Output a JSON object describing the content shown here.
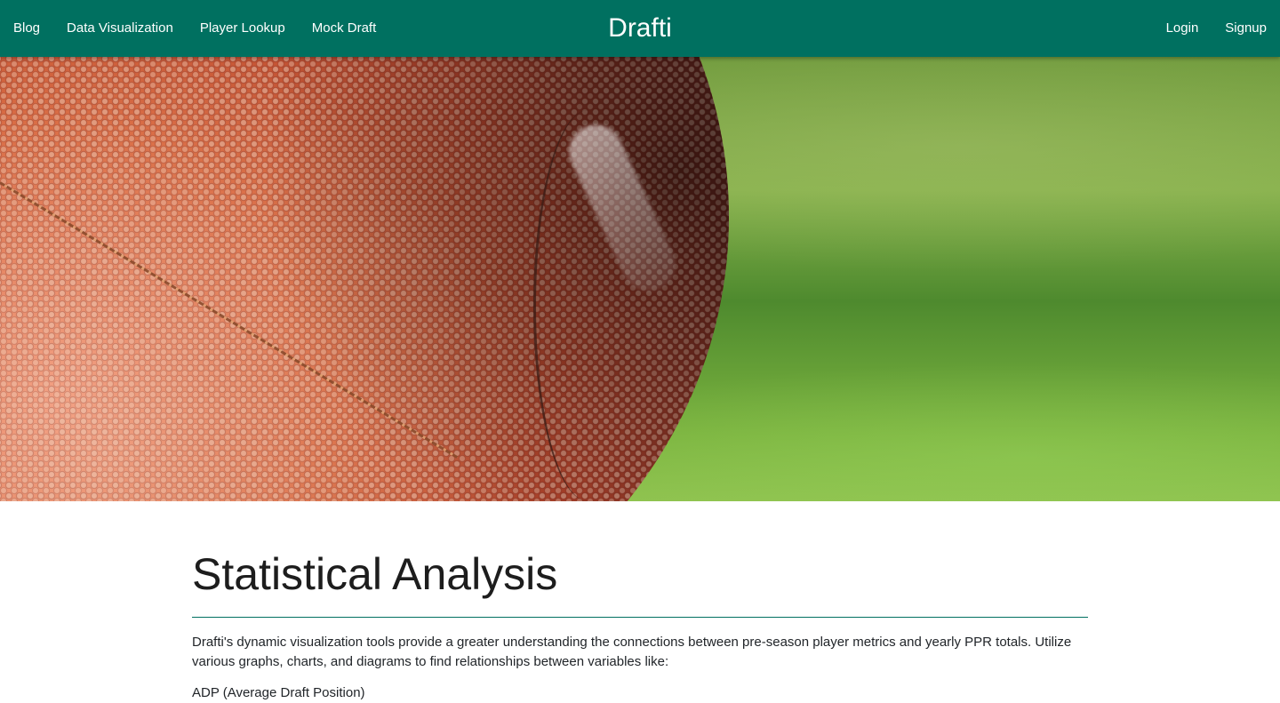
{
  "nav": {
    "left_links": [
      "Blog",
      "Data Visualization",
      "Player Lookup",
      "Mock Draft"
    ],
    "brand": "Drafti",
    "right_links": [
      "Login",
      "Signup"
    ]
  },
  "colors": {
    "navbar": "#007060",
    "divider": "#007060",
    "text": "#212529"
  },
  "hero": {
    "image": "football-on-grass"
  },
  "main": {
    "title": "Statistical Analysis",
    "intro": "Drafti's dynamic visualization tools provide a greater understanding the connections between pre-season player metrics and yearly PPR totals. Utilize various graphs, charts, and diagrams to find relationships between variables like:",
    "metrics": [
      "ADP (Average Draft Position)"
    ]
  }
}
